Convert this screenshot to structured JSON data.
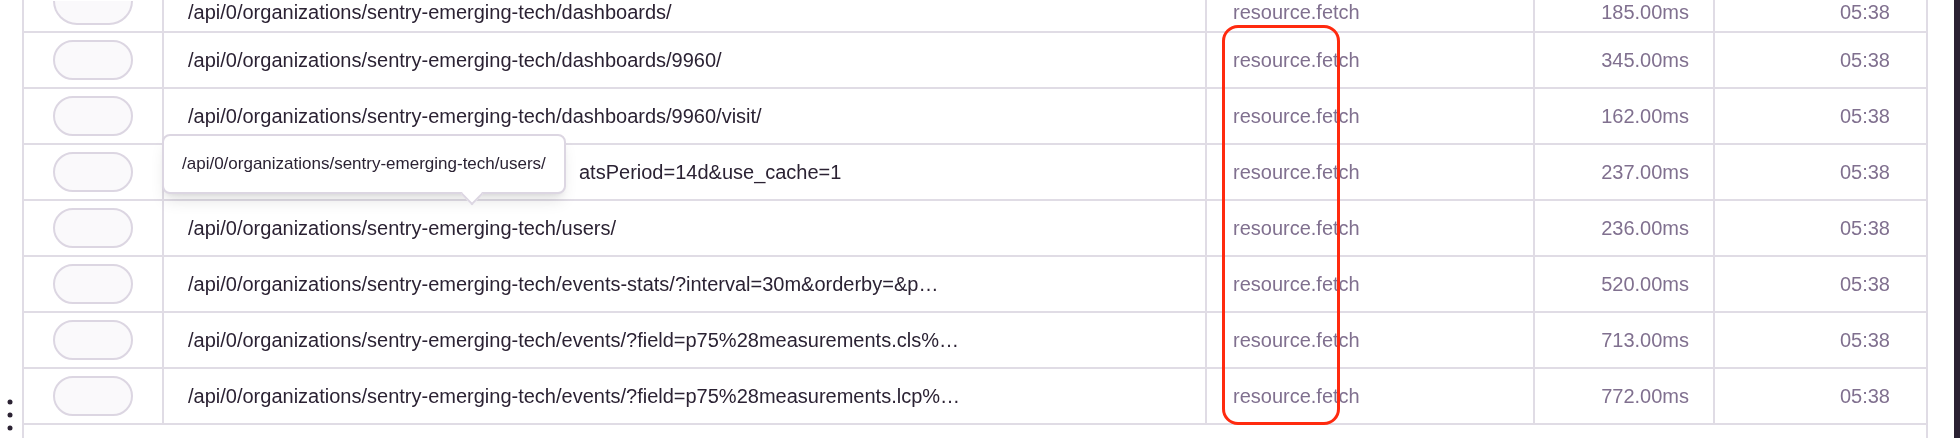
{
  "table": {
    "rows": [
      {
        "on": false,
        "description": "/api/0/organizations/sentry-emerging-tech/dashboards/",
        "operation": "resource.fetch",
        "duration": "185.00ms",
        "timestamp": "05:38"
      },
      {
        "on": false,
        "description": "/api/0/organizations/sentry-emerging-tech/dashboards/9960/",
        "operation": "resource.fetch",
        "duration": "345.00ms",
        "timestamp": "05:38"
      },
      {
        "on": false,
        "description": "/api/0/organizations/sentry-emerging-tech/dashboards/9960/visit/",
        "operation": "resource.fetch",
        "duration": "162.00ms",
        "timestamp": "05:38"
      },
      {
        "on": false,
        "description": "atsPeriod=14d&use_cache=1",
        "covered": true,
        "operation": "resource.fetch",
        "duration": "237.00ms",
        "timestamp": "05:38"
      },
      {
        "on": false,
        "description": "/api/0/organizations/sentry-emerging-tech/users/",
        "operation": "resource.fetch",
        "duration": "236.00ms",
        "timestamp": "05:38"
      },
      {
        "on": false,
        "description": "/api/0/organizations/sentry-emerging-tech/events-stats/?interval=30m&orderby=&p…",
        "operation": "resource.fetch",
        "duration": "520.00ms",
        "timestamp": "05:38"
      },
      {
        "on": false,
        "description": "/api/0/organizations/sentry-emerging-tech/events/?field=p75%28measurements.cls%…",
        "operation": "resource.fetch",
        "duration": "713.00ms",
        "timestamp": "05:38"
      },
      {
        "on": false,
        "description": "/api/0/organizations/sentry-emerging-tech/events/?field=p75%28measurements.lcp%…",
        "operation": "resource.fetch",
        "duration": "772.00ms",
        "timestamp": "05:38"
      }
    ]
  },
  "tooltip": {
    "text": "/api/0/organizations/sentry-emerging-tech/users/"
  }
}
